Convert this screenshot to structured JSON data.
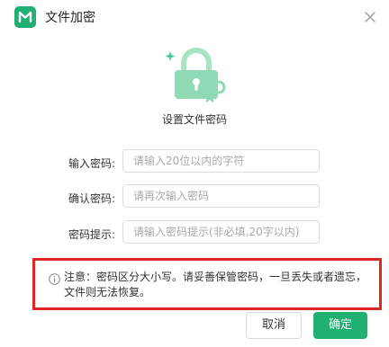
{
  "dialog": {
    "title": "文件加密",
    "heading": "设置文件密码"
  },
  "fields": [
    {
      "label": "输入密码:",
      "placeholder": "请输入20位以内的字符",
      "value": ""
    },
    {
      "label": "确认密码:",
      "placeholder": "请再次输入密码",
      "value": ""
    },
    {
      "label": "密码提示:",
      "placeholder": "请输入密码提示(非必填,20字以内)",
      "value": ""
    }
  ],
  "notice": {
    "text": "注意：密码区分大小写。请妥善保管密码，一旦丢失或者遗忘，文件则无法恢复。"
  },
  "buttons": {
    "cancel": "取消",
    "ok": "确定"
  },
  "colors": {
    "brand": "#1fb072",
    "illustration": "#8fd9b4",
    "highlight_border": "#e02525"
  },
  "icons": [
    "app-logo",
    "close-icon",
    "lock-key-illustration",
    "info-icon"
  ]
}
